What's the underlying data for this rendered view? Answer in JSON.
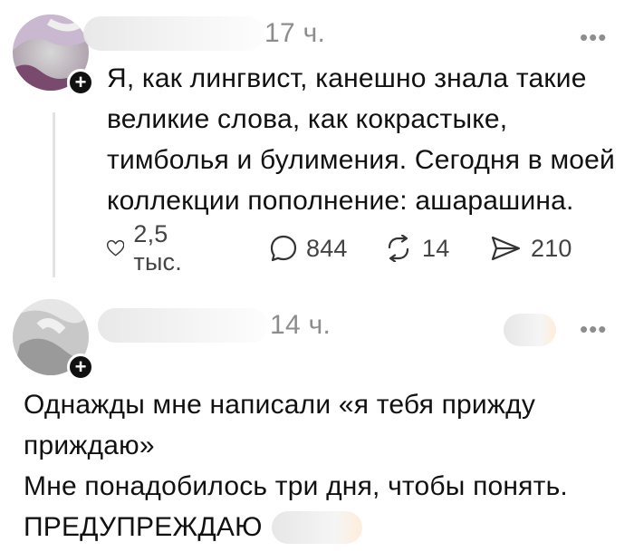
{
  "posts": [
    {
      "time": "17 ч.",
      "more_label": "•••",
      "text_lines": [
        "Я, как лингвист, канешно знала такие",
        "великие слова, как кокрастыке,",
        "тимболья и булимения. Сегодня в моей",
        "коллекции пополнение: ашарашина."
      ],
      "actions": {
        "likes": "2,5 тыс.",
        "comments": "844",
        "reposts": "14",
        "shares": "210"
      },
      "follow_label": "+"
    },
    {
      "time": "14 ч.",
      "more_label": "•••",
      "text_lines": [
        "Однажды мне написали «я тебя прижду",
        "приждаю»",
        "Мне понадобилось три дня, чтобы понять.",
        "ПРЕДУПРЕЖДАЮ"
      ],
      "follow_label": "+"
    }
  ],
  "colors": {
    "text": "#111111",
    "muted": "#8d8d8d",
    "divider": "#e3e3e3"
  },
  "icons": [
    "heart-icon",
    "comment-icon",
    "repost-icon",
    "share-icon",
    "plus-icon",
    "more-icon"
  ]
}
